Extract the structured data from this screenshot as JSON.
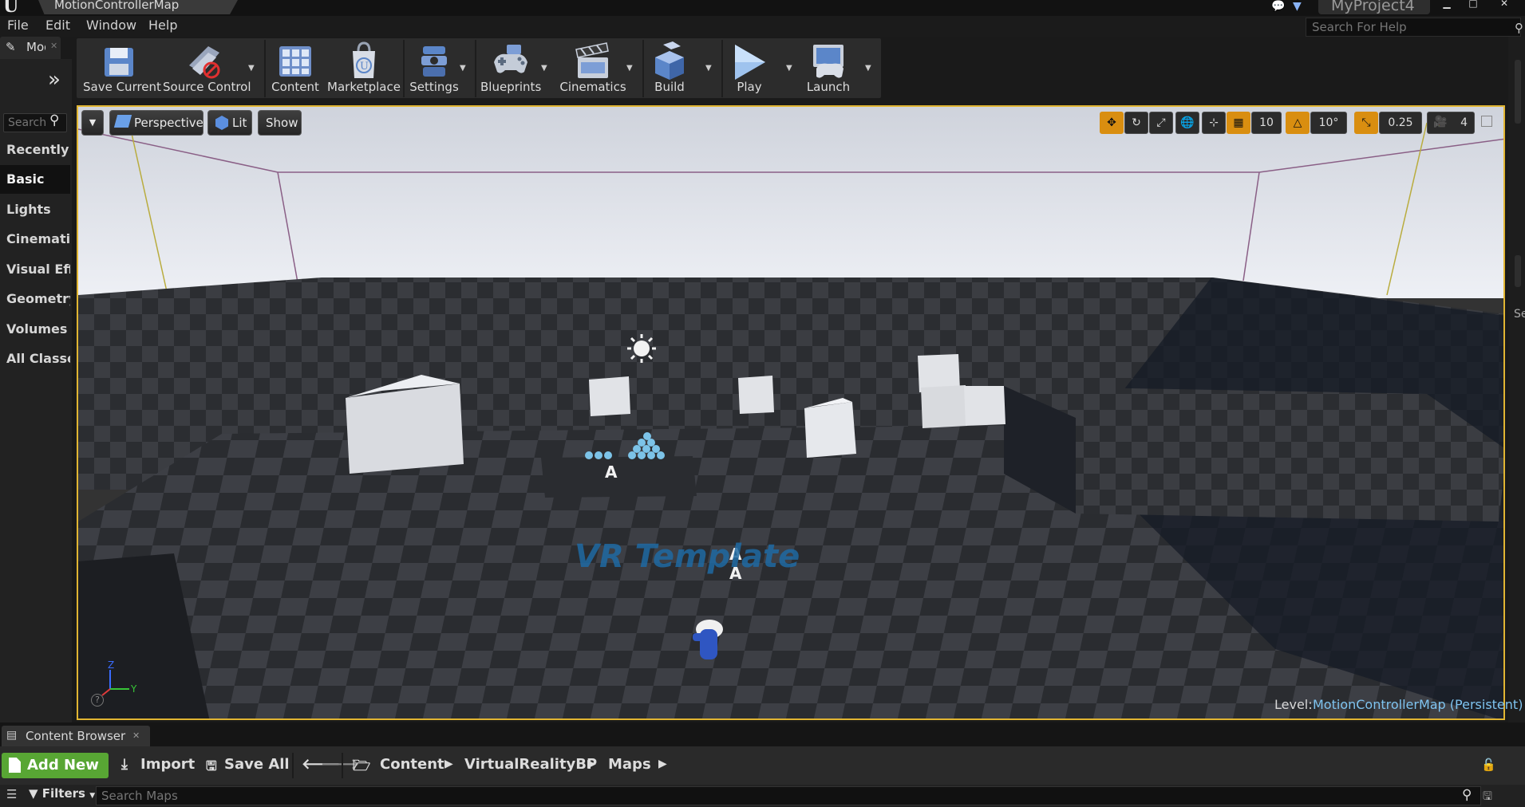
{
  "window": {
    "tab_title": "MotionControllerMap",
    "project_name": "MyProject4",
    "controls": [
      "▁",
      "□",
      "✕"
    ]
  },
  "menu": {
    "items": [
      "File",
      "Edit",
      "Window",
      "Help"
    ],
    "help_search_placeholder": "Search For Help"
  },
  "modes_panel": {
    "tab_label": "Modes",
    "search_placeholder": "Search",
    "categories": [
      "Recently Placed",
      "Basic",
      "Lights",
      "Cinematic",
      "Visual Effects",
      "Geometry",
      "Volumes",
      "All Classes"
    ],
    "selected": "Basic"
  },
  "toolbar": {
    "buttons": [
      {
        "label": "Save Current",
        "icon": "save-icon"
      },
      {
        "label": "Source Control",
        "icon": "source-control-icon"
      },
      {
        "label": "Content",
        "icon": "content-icon"
      },
      {
        "label": "Marketplace",
        "icon": "marketplace-icon"
      },
      {
        "label": "Settings",
        "icon": "settings-icon"
      },
      {
        "label": "Blueprints",
        "icon": "blueprints-icon"
      },
      {
        "label": "Cinematics",
        "icon": "cinematics-icon"
      },
      {
        "label": "Build",
        "icon": "build-icon"
      },
      {
        "label": "Play",
        "icon": "play-icon"
      },
      {
        "label": "Launch",
        "icon": "launch-icon"
      }
    ]
  },
  "viewport": {
    "view_mode": "Perspective",
    "lighting": "Lit",
    "show_label": "Show",
    "grid_snap": "10",
    "rotation_snap": "10°",
    "scale_snap": "0.25",
    "camera_speed": "4",
    "level_label": "Level:",
    "level_name": "MotionControllerMap (Persistent)",
    "floor_text": "VR Template",
    "axis_labels": {
      "z": "Z",
      "y": "Y"
    },
    "actor_labels": [
      "A",
      "A",
      "A"
    ]
  },
  "right_strip": {
    "label": "Se"
  },
  "content_browser": {
    "tab_label": "Content Browser",
    "add_new": "Add New",
    "import": "Import",
    "save_all": "Save All",
    "breadcrumbs": [
      "Content",
      "VirtualRealityBP",
      "Maps"
    ],
    "filters_label": "Filters",
    "search_placeholder": "Search Maps"
  },
  "colors": {
    "accent_viewport_border": "#e1b532",
    "snap_active": "#d98e10",
    "add_new_green": "#58a634",
    "level_name_blue": "#7fc4f0"
  }
}
